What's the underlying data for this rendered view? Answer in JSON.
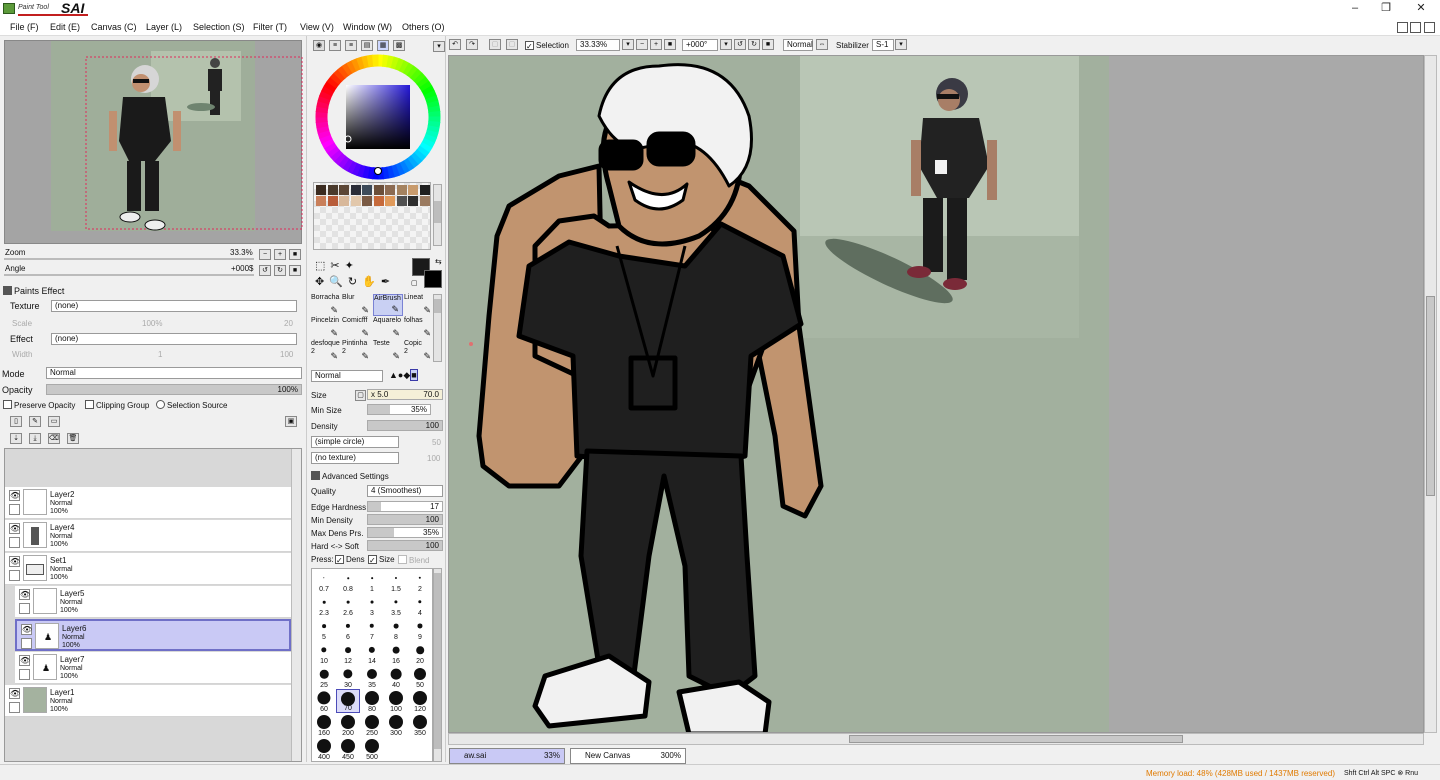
{
  "app": {
    "logo_small": "Paint Tool",
    "logo_big": "SAI"
  },
  "window_buttons": {
    "minimize": "–",
    "restore": "❐",
    "close": "✕"
  },
  "menu": [
    "File (F)",
    "Edit (E)",
    "Canvas (C)",
    "Layer (L)",
    "Selection (S)",
    "Filter (T)",
    "View (V)",
    "Window (W)",
    "Others (O)"
  ],
  "navigator": {
    "zoom_label": "Zoom",
    "zoom_value": "33.3%",
    "angle_label": "Angle",
    "angle_value": "+000$"
  },
  "paints_effect": {
    "title": "Paints Effect",
    "texture_label": "Texture",
    "texture_value": "(none)",
    "scale_label": "Scale",
    "scale_value": "100%",
    "scale_num": "20",
    "effect_label": "Effect",
    "effect_value": "(none)",
    "width_label": "Width",
    "width_value": "1",
    "width_num": "100"
  },
  "layer_props": {
    "mode_label": "Mode",
    "mode_value": "Normal",
    "opacity_label": "Opacity",
    "opacity_value": "100%",
    "opacity_fraction": 1.0,
    "preserve_opacity": "Preserve Opacity",
    "clipping_group": "Clipping Group",
    "selection_source": "Selection Source"
  },
  "layers": [
    {
      "name": "Layer2",
      "mode": "Normal",
      "opacity": "100%",
      "thumb": ""
    },
    {
      "name": "Layer4",
      "mode": "Normal",
      "opacity": "100%",
      "thumb": "figure"
    },
    {
      "name": "Set1",
      "mode": "Normal",
      "opacity": "100%",
      "thumb": "folder"
    },
    {
      "name": "Layer5",
      "mode": "Normal",
      "opacity": "100%",
      "thumb": ""
    },
    {
      "name": "Layer6",
      "mode": "Normal",
      "opacity": "100%",
      "thumb": "glyph"
    },
    {
      "name": "Layer7",
      "mode": "Normal",
      "opacity": "100%",
      "thumb": "glyph"
    },
    {
      "name": "Layer1",
      "mode": "Normal",
      "opacity": "100%",
      "thumb": "fill"
    }
  ],
  "swatches": [
    "#3a2b20",
    "#4a3a2c",
    "#5b4636",
    "#2a2d38",
    "#3d4b5a",
    "#6b4f3a",
    "#8c6b52",
    "#a4825f",
    "#c89b6d",
    "#1f1f1f",
    "#c97f5a",
    "#b85d3a",
    "#d8b89a",
    "#e2c8ac",
    "#7a5a44",
    "#c66a3b",
    "#e09a5b",
    "#505050",
    "#2e2e2e",
    "#9a7a60"
  ],
  "tools": [
    {
      "name": "Borracha",
      "size": ""
    },
    {
      "name": "Blur",
      "size": ""
    },
    {
      "name": "AirBrush",
      "size": ""
    },
    {
      "name": "Lineat",
      "size": ""
    },
    {
      "name": "Pincelzin",
      "size": ""
    },
    {
      "name": "Comicfff",
      "size": ""
    },
    {
      "name": "Aquarelo",
      "size": ""
    },
    {
      "name": "folhas",
      "size": ""
    },
    {
      "name": "desfoque",
      "size": "2"
    },
    {
      "name": "Pintinha",
      "size": "2"
    },
    {
      "name": "Teste",
      "size": ""
    },
    {
      "name": "Copic",
      "size": "2"
    }
  ],
  "brush": {
    "blend_mode": "Normal",
    "size_label": "Size",
    "size_mult": "x 5.0",
    "size_value": "70.0",
    "min_size_label": "Min Size",
    "min_size_value": "35%",
    "min_size_fraction": 0.35,
    "density_label": "Density",
    "density_value": "100",
    "density_fraction": 1.0,
    "shape": "(simple circle)",
    "shape_num": "50",
    "texture": "(no texture)",
    "texture_num": "100",
    "advanced_title": "Advanced Settings",
    "quality_label": "Quality",
    "quality_value": "4 (Smoothest)",
    "edge_label": "Edge Hardness",
    "edge_value": "17",
    "edge_fraction": 0.17,
    "min_density_label": "Min Density",
    "min_density_value": "100",
    "min_density_fraction": 1.0,
    "max_dens_label": "Max Dens Prs.",
    "max_dens_value": "35%",
    "max_dens_fraction": 0.35,
    "hard_soft_label": "Hard <-> Soft",
    "hard_soft_value": "100",
    "hard_soft_fraction": 1.0,
    "press_label": "Press:",
    "press_dens": "Dens",
    "press_size": "Size",
    "press_blend": "Blend"
  },
  "brush_sizes": [
    "0.7",
    "0.8",
    "1",
    "1.5",
    "2",
    "2.3",
    "2.6",
    "3",
    "3.5",
    "4",
    "5",
    "6",
    "7",
    "8",
    "9",
    "10",
    "12",
    "14",
    "16",
    "20",
    "25",
    "30",
    "35",
    "40",
    "50",
    "60",
    "70",
    "80",
    "100",
    "120",
    "160",
    "200",
    "250",
    "300",
    "350",
    "400",
    "450",
    "500"
  ],
  "selected_brush_size": "70",
  "canvas_toolbar": {
    "selection_label": "Selection",
    "zoom": "33.33%",
    "angle": "+000°",
    "mode": "Normal",
    "stabilizer_label": "Stabilizer",
    "stabilizer_value": "S-1"
  },
  "tabs": [
    {
      "name": "aw.sai",
      "zoom": "33%",
      "active": true
    },
    {
      "name": "New Canvas",
      "zoom": "300%",
      "active": false
    }
  ],
  "status": {
    "memory": "Memory load: 48% (428MB used / 1437MB reserved)",
    "keys": [
      "Shft",
      "Ctrl",
      "Alt",
      "SPC"
    ],
    "key_last": "Rnu"
  }
}
